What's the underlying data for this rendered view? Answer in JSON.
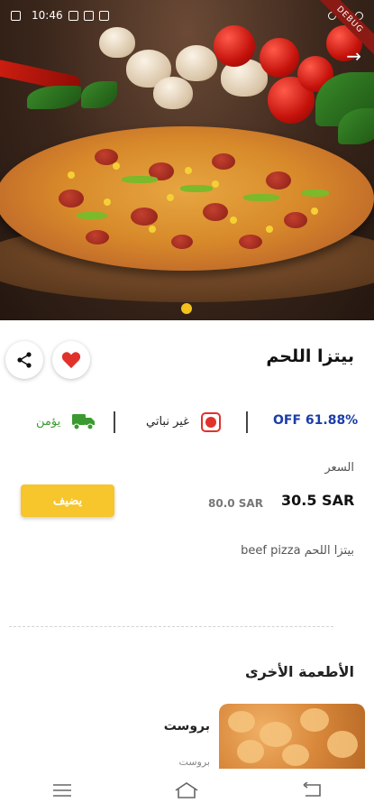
{
  "status_bar": {
    "time": "10:46",
    "debug_label": "DEBUG"
  },
  "product": {
    "name": "بيتزا اللحم",
    "discount": "OFF 61.88%",
    "veg_label": "غير نباتي",
    "delivery_label": "يؤمن",
    "price_label": "السعر",
    "price": "30.5 SAR",
    "old_price": "80.0 SAR",
    "add_button": "يضيف",
    "description": "beef pizza بيتزا اللحم"
  },
  "other_foods": {
    "title": "الأطعمة الأخرى",
    "items": [
      {
        "name": "بروست",
        "subtitle": "بروست"
      }
    ]
  },
  "colors": {
    "accent": "#F7C52C",
    "discount": "#1B3DA8",
    "favorite": "#E0322B",
    "delivery": "#3A9A2F"
  },
  "icons": [
    "share-icon",
    "heart-icon",
    "truck-icon",
    "veg-indicator-icon",
    "forward-arrow-icon",
    "menu-icon",
    "home-icon",
    "back-icon"
  ]
}
